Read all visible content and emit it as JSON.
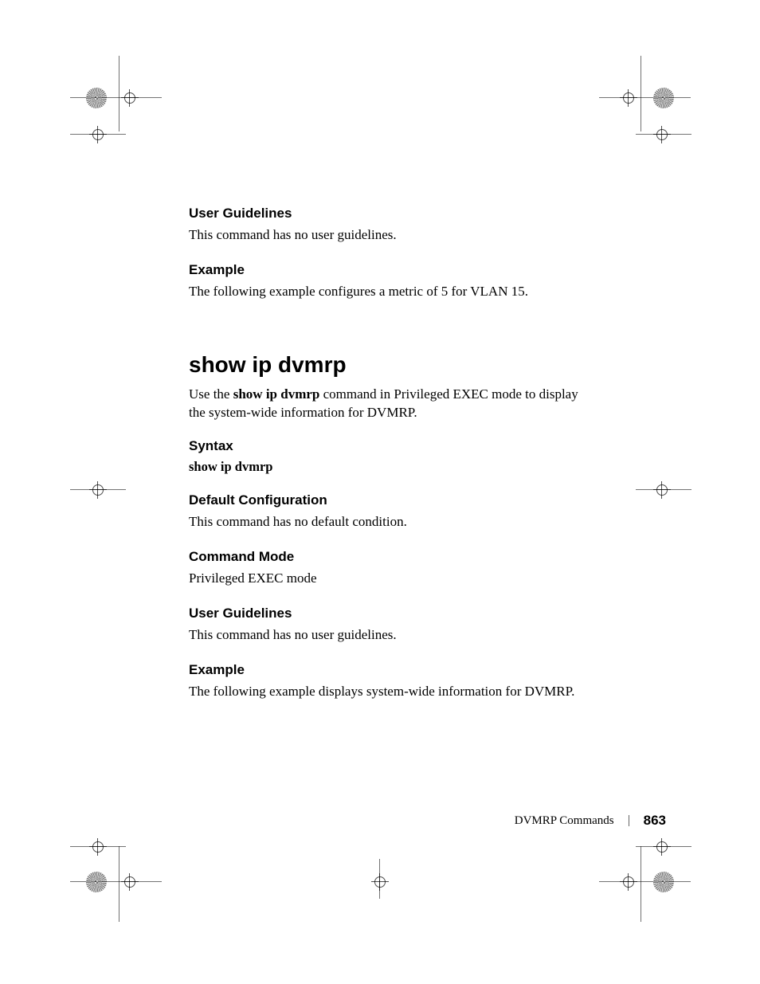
{
  "sections": {
    "guidelines1": {
      "heading": "User Guidelines",
      "body": "This command has no user guidelines."
    },
    "example1": {
      "heading": "Example",
      "body": "The following example configures a metric of 5 for VLAN 15."
    },
    "command": {
      "title": "show ip dvmrp",
      "intro_pre": "Use the ",
      "intro_cmd": "show ip dvmrp",
      "intro_post": " command in Privileged EXEC mode to display the system-wide information for DVMRP."
    },
    "syntax": {
      "heading": "Syntax",
      "line": "show ip dvmrp"
    },
    "default": {
      "heading": "Default Configuration",
      "body": "This command has no default condition."
    },
    "mode": {
      "heading": "Command Mode",
      "body": "Privileged EXEC mode"
    },
    "guidelines2": {
      "heading": "User Guidelines",
      "body": "This command has no user guidelines."
    },
    "example2": {
      "heading": "Example",
      "body": "The following example displays system-wide information for DVMRP."
    }
  },
  "footer": {
    "label": "DVMRP Commands",
    "page": "863"
  }
}
